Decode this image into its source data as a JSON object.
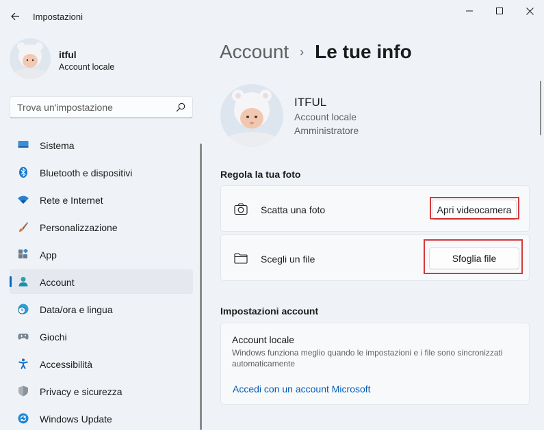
{
  "window": {
    "title": "Impostazioni"
  },
  "user": {
    "name": "itful",
    "type": "Account locale"
  },
  "search": {
    "placeholder": "Trova un'impostazione"
  },
  "nav": {
    "items": [
      {
        "label": "Sistema",
        "icon": "monitor-icon"
      },
      {
        "label": "Bluetooth e dispositivi",
        "icon": "bluetooth-icon"
      },
      {
        "label": "Rete e Internet",
        "icon": "wifi-icon"
      },
      {
        "label": "Personalizzazione",
        "icon": "brush-icon"
      },
      {
        "label": "App",
        "icon": "apps-icon"
      },
      {
        "label": "Account",
        "icon": "person-icon",
        "active": true
      },
      {
        "label": "Data/ora e lingua",
        "icon": "clock-globe-icon"
      },
      {
        "label": "Giochi",
        "icon": "gamepad-icon"
      },
      {
        "label": "Accessibilità",
        "icon": "accessibility-icon"
      },
      {
        "label": "Privacy e sicurezza",
        "icon": "shield-icon"
      },
      {
        "label": "Windows Update",
        "icon": "update-icon"
      }
    ]
  },
  "breadcrumb": {
    "parent": "Account",
    "separator": "›",
    "current": "Le tue info"
  },
  "profile": {
    "name": "ITFUL",
    "type": "Account locale",
    "role": "Amministratore"
  },
  "photo_section": {
    "title": "Regola la tua foto",
    "take_photo_label": "Scatta una foto",
    "take_photo_button": "Apri videocamera",
    "choose_file_label": "Scegli un file",
    "choose_file_button": "Sfoglia file"
  },
  "account_section": {
    "title": "Impostazioni account",
    "card_title": "Account locale",
    "card_description": "Windows funziona meglio quando le impostazioni e i file sono sincronizzati automaticamente",
    "link": "Accedi con un account Microsoft"
  },
  "colors": {
    "accent": "#0067c0",
    "highlight": "#d33a3a",
    "background": "#eff3f8"
  }
}
